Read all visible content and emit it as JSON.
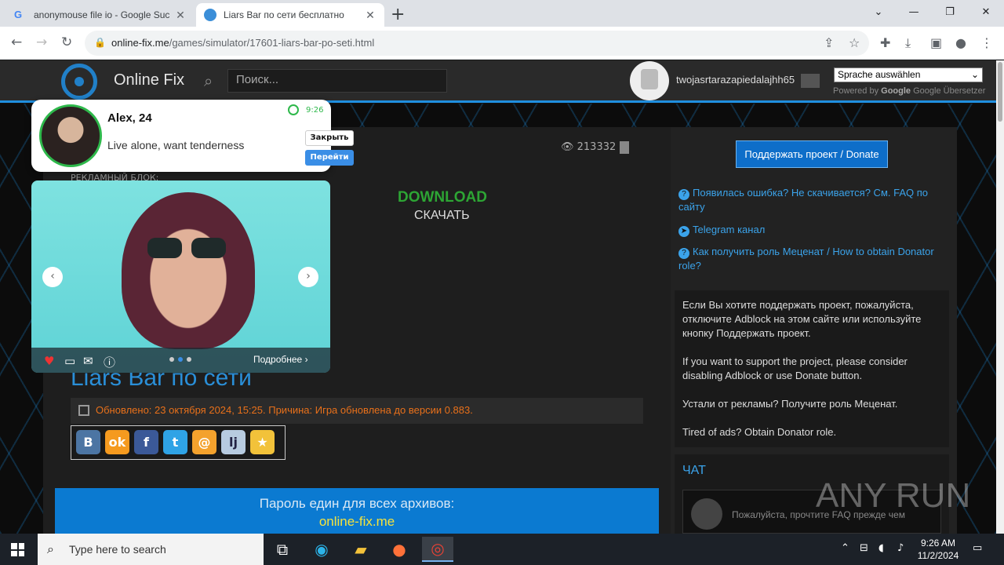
{
  "browser": {
    "tabs": [
      {
        "title": "anonymousе file io - Google Suc",
        "icon": "google-icon"
      },
      {
        "title": "Liars Bar по сети бесплатно",
        "icon": "globe-icon"
      }
    ],
    "url_domain": "online-fix.me",
    "url_path": "/games/simulator/17601-liars-bar-po-seti.html"
  },
  "site": {
    "name": "Online Fix",
    "search_placeholder": "Поиск...",
    "username": "twojasrtarazapiedalajhh65",
    "lang_select": "Sprache auswählen",
    "powered_by": "Powered by",
    "google": "Google",
    "translate": "Google Übersetzer"
  },
  "popup": {
    "name": "Alex, 24",
    "message": "Live alone, want tenderness",
    "time": "9:26",
    "close_label": "Закрыть",
    "go_label": "Перейти"
  },
  "slider": {
    "more_label": "Подробнее"
  },
  "content": {
    "views": "213332",
    "ad_label": "РЕКЛАМНЫЙ БЛОК:",
    "download_en": "DOWNLOAD",
    "download_ru": "СКАЧАТЬ",
    "title": "Liars Bar по сети",
    "updated": "Обновлено: 23 октября 2024, 15:25. Причина: Игра обновлена до версии 0.883.",
    "password_line": "Пароль един для всех архивов:",
    "password_value": "online-fix.me",
    "share_buttons": [
      "В",
      "ok",
      "f",
      "t",
      "@",
      "lj",
      "★"
    ]
  },
  "sidebar": {
    "donate_label": "Поддержать проект / Donate",
    "links": [
      "Появилась ошибка? Не скачивается? См. FAQ по сайту",
      "Telegram канал",
      "Как получить роль Меценат / How to obtain Donator role?"
    ],
    "adblock_ru": "Если Вы хотите поддержать проект, пожалуйста, отключите Adblock на этом сайте или используйте кнопку Поддержать проект.",
    "adblock_en": "If you want to support the project, please consider disabling Adblock or use Donate button.",
    "ads_ru": "Устали от рекламы? Получите роль Меценат.",
    "ads_en": "Tired of ads? Obtain Donator role.",
    "chat_title": "ЧАТ",
    "chat_text": "Пожалуйста, прочтите FAQ прежде чем"
  },
  "watermark": "ANY RUN",
  "taskbar": {
    "search_placeholder": "Type here to search",
    "time": "9:26 AM",
    "date": "11/2/2024"
  }
}
